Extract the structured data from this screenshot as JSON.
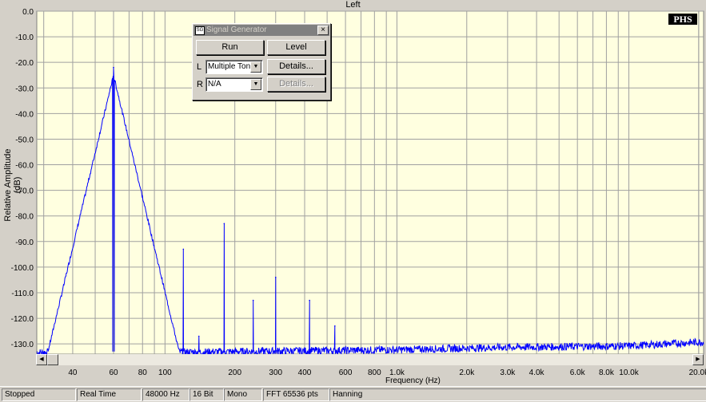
{
  "window": {
    "channel_title": "Left",
    "logo_text": "PHS"
  },
  "axes": {
    "ylabel": "Relative Amplitude (dB)",
    "xlabel": "Frequency (Hz)",
    "y_ticks": [
      "0.0",
      "-10.0",
      "-20.0",
      "-30.0",
      "-40.0",
      "-50.0",
      "-60.0",
      "-70.0",
      "-80.0",
      "-90.0",
      "-100.0",
      "-110.0",
      "-120.0",
      "-130.0"
    ],
    "x_ticks": [
      "40",
      "60",
      "80",
      "100",
      "200",
      "300",
      "400",
      "600",
      "800",
      "1.0k",
      "2.0k",
      "3.0k",
      "4.0k",
      "6.0k",
      "8.0k",
      "10.0k",
      "20.0k"
    ]
  },
  "chart_data": {
    "type": "line",
    "xlabel": "Frequency (Hz)",
    "ylabel": "Relative Amplitude (dB)",
    "x_scale": "log",
    "xlim": [
      28,
      21000
    ],
    "ylim": [
      -134,
      0
    ],
    "grid": true,
    "line_color": "#0000ff",
    "peaks": [
      {
        "x": 60,
        "y": -22
      },
      {
        "x": 120,
        "y": -93
      },
      {
        "x": 140,
        "y": -127
      },
      {
        "x": 180,
        "y": -83
      },
      {
        "x": 240,
        "y": -113
      },
      {
        "x": 300,
        "y": -104
      },
      {
        "x": 420,
        "y": -113
      },
      {
        "x": 540,
        "y": -123
      }
    ],
    "noise_floor": [
      {
        "x": 100,
        "y": -133
      },
      {
        "x": 1000,
        "y": -132
      },
      {
        "x": 3000,
        "y": -131
      },
      {
        "x": 10000,
        "y": -130.5
      },
      {
        "x": 20000,
        "y": -129
      }
    ]
  },
  "signal_generator": {
    "title": "Signal Generator",
    "close_label": "×",
    "run_label": "Run",
    "level_label": "Level",
    "left_label": "L",
    "right_label": "R",
    "left_value": "Multiple Ton",
    "right_value": "N/A",
    "details_label": "Details...",
    "details_disabled_label": "Details..."
  },
  "status_bar": {
    "state": "Stopped",
    "mode": "Real Time",
    "sample_rate": "48000 Hz",
    "bits": "16 Bit",
    "channels": "Mono",
    "fft": "FFT 65536 pts",
    "window": "Hanning"
  }
}
